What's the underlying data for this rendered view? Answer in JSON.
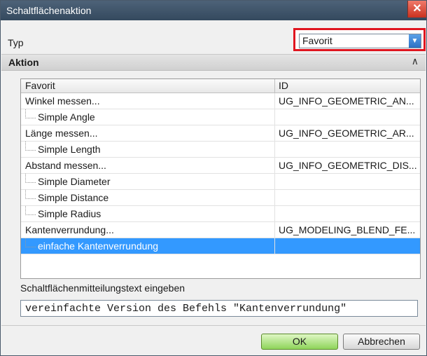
{
  "window": {
    "title": "Schaltflächenaktion",
    "close_glyph": "✕"
  },
  "typ": {
    "label": "Typ",
    "value": "Favorit",
    "arrow_glyph": "▼"
  },
  "aktion": {
    "title": "Aktion",
    "collapse_glyph": "∧"
  },
  "table": {
    "columns": [
      "Favorit",
      "ID"
    ],
    "rows": [
      {
        "name": "Winkel messen...",
        "id": "UG_INFO_GEOMETRIC_AN...",
        "child": false,
        "selected": false
      },
      {
        "name": "Simple Angle",
        "id": "",
        "child": true,
        "selected": false
      },
      {
        "name": "Länge messen...",
        "id": "UG_INFO_GEOMETRIC_AR...",
        "child": false,
        "selected": false
      },
      {
        "name": "Simple Length",
        "id": "",
        "child": true,
        "selected": false
      },
      {
        "name": "Abstand messen...",
        "id": "UG_INFO_GEOMETRIC_DIS...",
        "child": false,
        "selected": false
      },
      {
        "name": "Simple Diameter",
        "id": "",
        "child": true,
        "selected": false
      },
      {
        "name": "Simple Distance",
        "id": "",
        "child": true,
        "selected": false
      },
      {
        "name": "Simple Radius",
        "id": "",
        "child": true,
        "selected": false
      },
      {
        "name": "Kantenverrundung...",
        "id": "UG_MODELING_BLEND_FE...",
        "child": false,
        "selected": false
      },
      {
        "name": "einfache Kantenverrundung",
        "id": "",
        "child": true,
        "selected": true
      }
    ]
  },
  "message": {
    "label": "Schaltflächenmitteilungstext eingeben",
    "value": "vereinfachte Version des Befehls \"Kantenverrundung\""
  },
  "buttons": {
    "ok": "OK",
    "cancel": "Abbrechen"
  },
  "colors": {
    "selection": "#3399ff",
    "highlight_border": "#e0151f",
    "ok_green": "#8ed45a"
  }
}
